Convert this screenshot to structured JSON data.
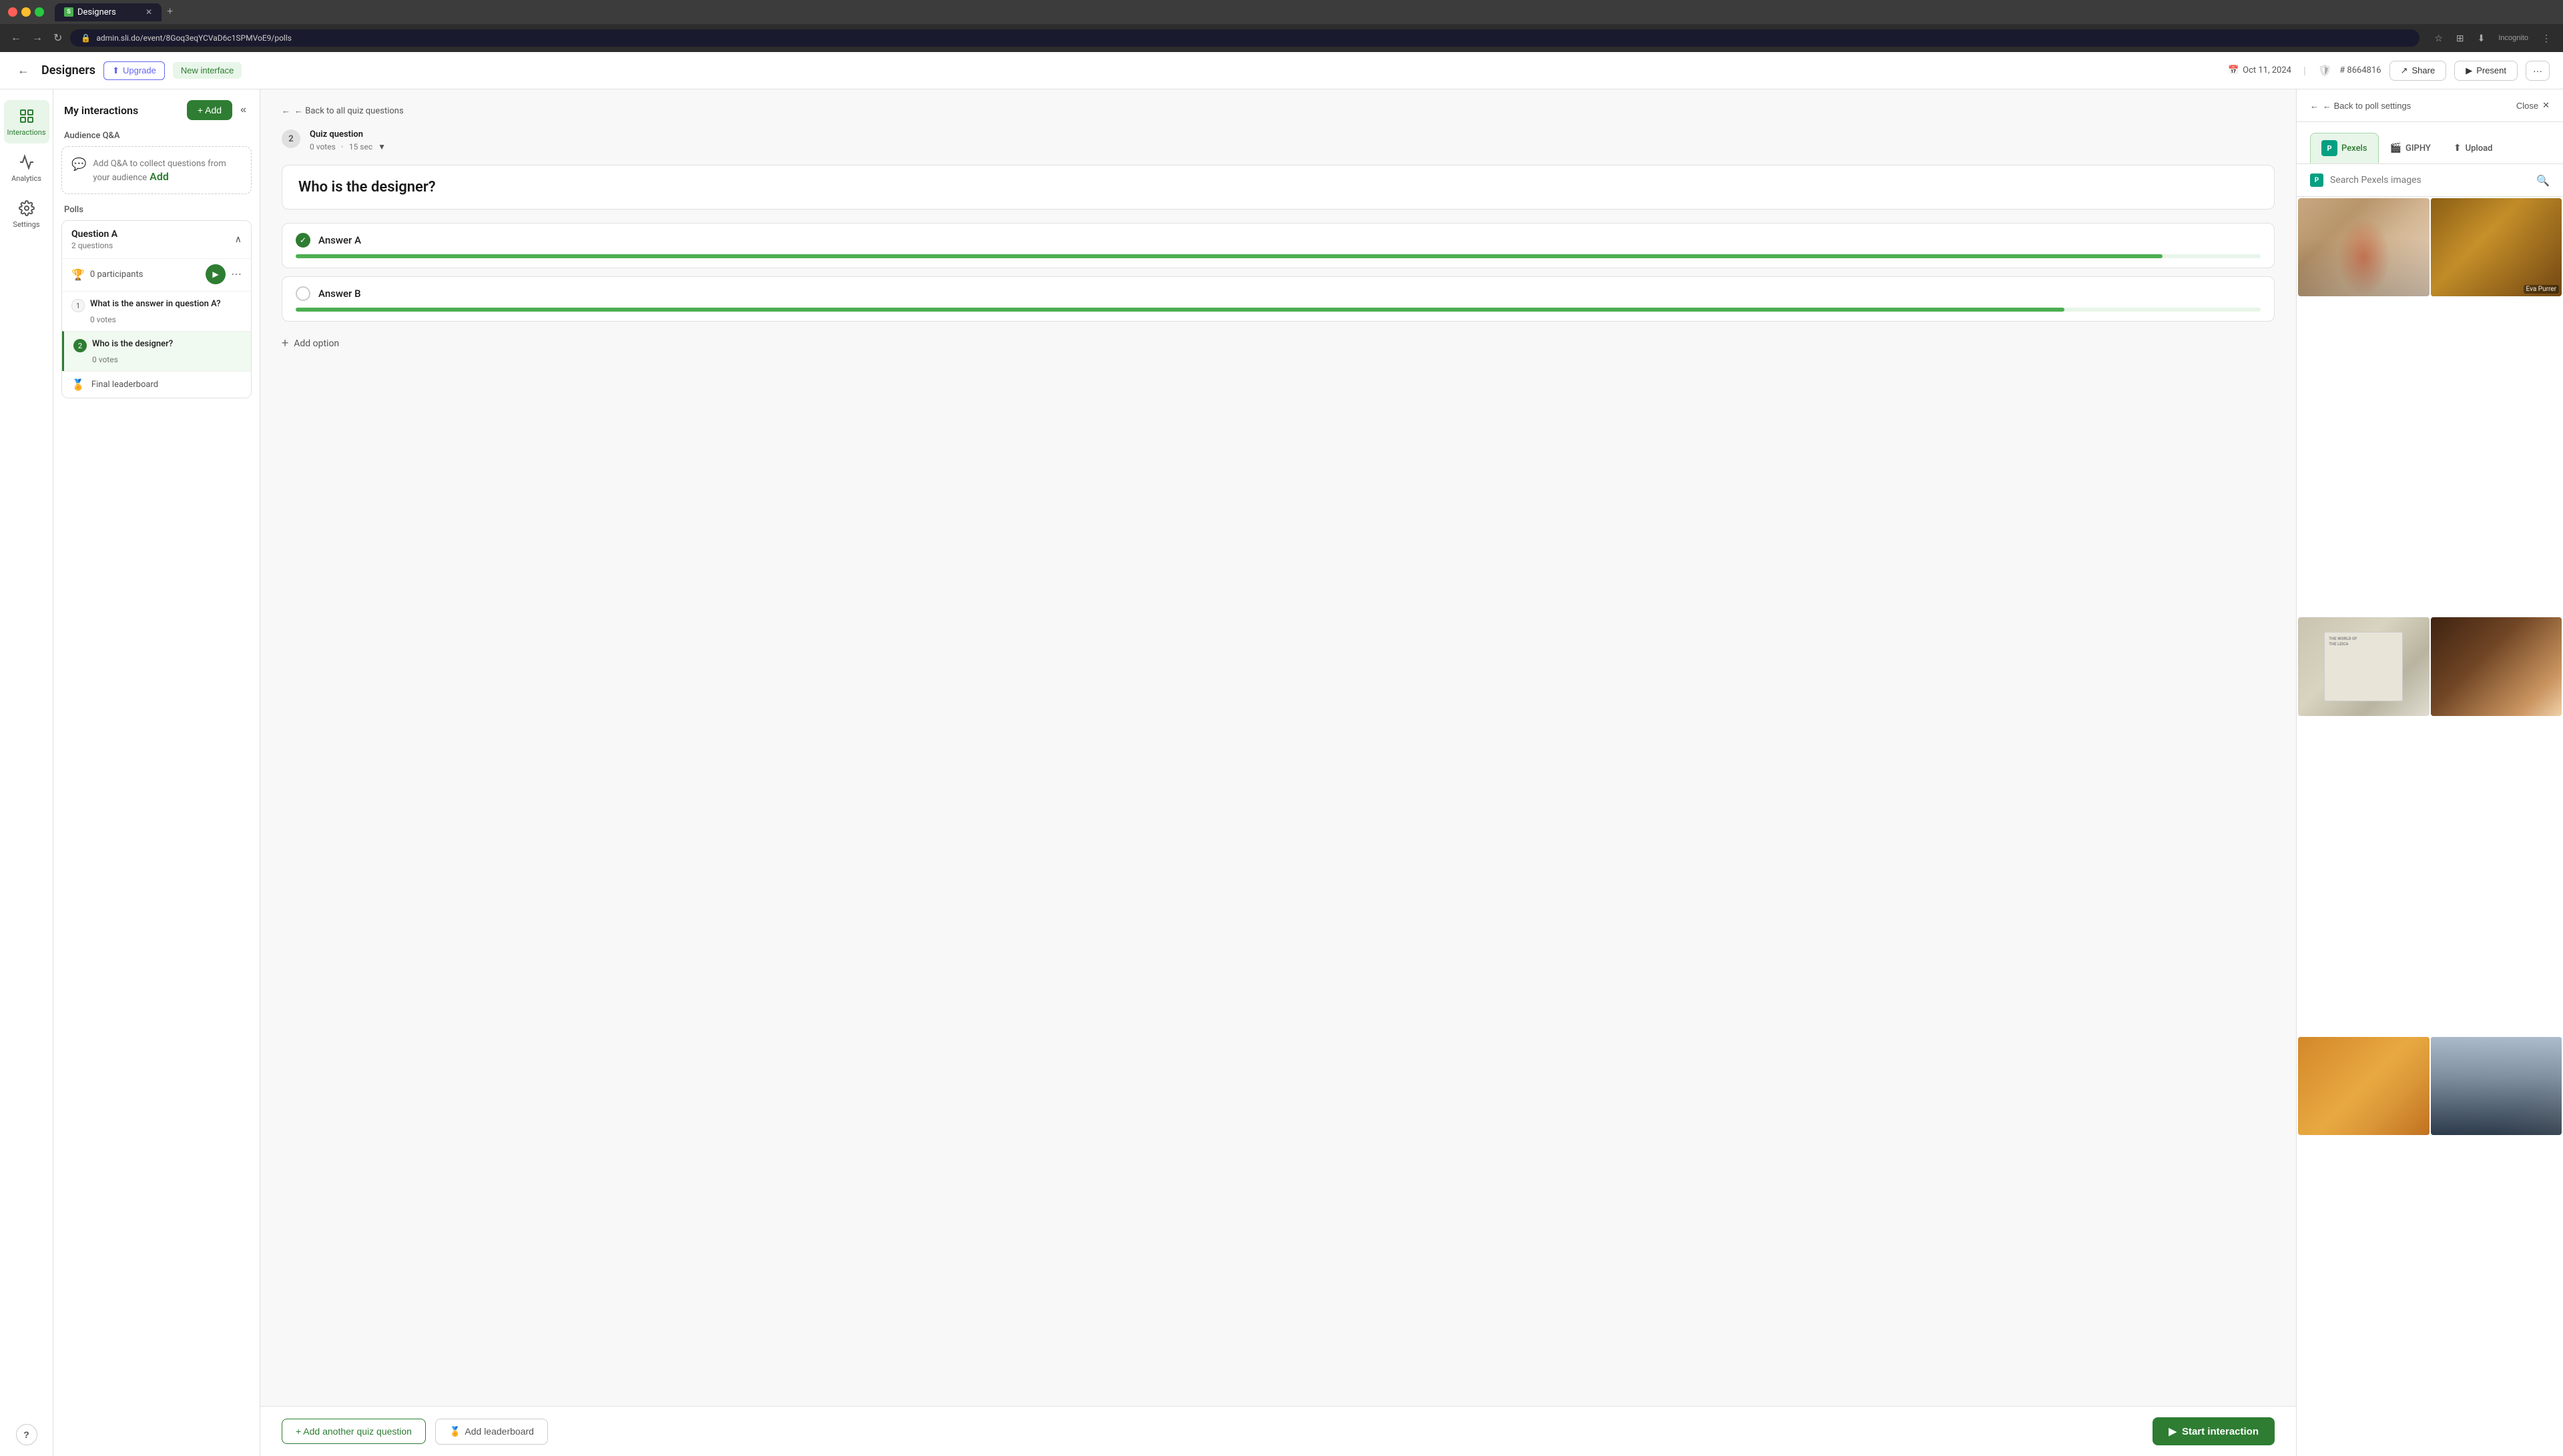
{
  "browser": {
    "url": "admin.sli.do/event/8Goq3eqYCVaD6c1SPMVoE9/polls",
    "tab_title": "Designers",
    "tab_favicon": "S"
  },
  "header": {
    "back_label": "←",
    "title": "Designers",
    "upgrade_label": "Upgrade",
    "new_interface_label": "New interface",
    "date": "Oct 11, 2024",
    "event_id": "# 8664816",
    "share_label": "Share",
    "present_label": "Present",
    "more_label": "···"
  },
  "sidebar": {
    "interactions_label": "Interactions",
    "analytics_label": "Analytics",
    "settings_label": "Settings"
  },
  "interactions_panel": {
    "title": "My interactions",
    "add_label": "+ Add",
    "collapse_label": "«",
    "audience_qa_label": "Audience Q&A",
    "qa_prompt": "Add Q&A to collect questions from your audience",
    "qa_add": "Add",
    "polls_label": "Polls",
    "question_group": {
      "title": "Question A",
      "subtitle": "2 questions",
      "participants": "0 participants",
      "questions": [
        {
          "num": "1",
          "title": "What is the answer in question A?",
          "votes": "0 votes"
        },
        {
          "num": "2",
          "title": "Who is the designer?",
          "votes": "0 votes",
          "active": true
        }
      ],
      "final_leaderboard": "Final leaderboard"
    }
  },
  "main_content": {
    "back_link": "← Back to all quiz questions",
    "question_num": "2",
    "quiz_type": "Quiz question",
    "votes": "0 votes",
    "time": "15 sec",
    "question_text": "Who is the designer?",
    "answers": [
      {
        "label": "Answer A",
        "correct": true,
        "bar_width": "95%"
      },
      {
        "label": "Answer B",
        "correct": false,
        "bar_width": "90%"
      }
    ],
    "add_option_label": "Add option",
    "add_quiz_question_label": "+ Add another quiz question",
    "add_leaderboard_label": "Add leaderboard",
    "start_interaction_label": "▶ Start interaction"
  },
  "right_panel": {
    "back_label": "← Back to poll settings",
    "close_label": "Close ✕",
    "tabs": [
      {
        "label": "Pexels",
        "active": true
      },
      {
        "label": "GIPHY",
        "active": false
      },
      {
        "label": "Upload",
        "active": false
      }
    ],
    "search_placeholder": "Search Pexels images",
    "images": [
      {
        "id": "woman-red",
        "credit": ""
      },
      {
        "id": "lion",
        "credit": "Eva Purrer"
      },
      {
        "id": "book",
        "credit": ""
      },
      {
        "id": "coffee",
        "credit": ""
      },
      {
        "id": "croissant",
        "credit": ""
      },
      {
        "id": "city",
        "credit": ""
      }
    ]
  }
}
